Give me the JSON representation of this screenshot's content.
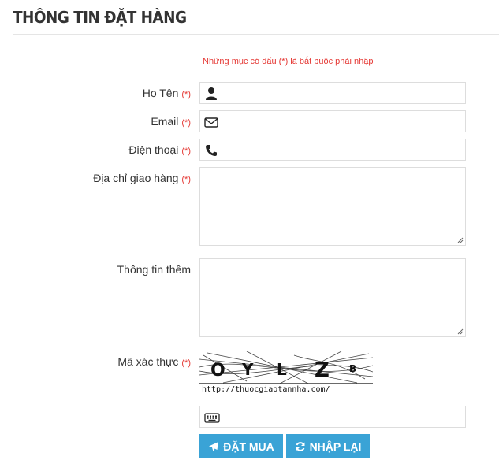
{
  "form": {
    "title": "THÔNG TIN ĐẶT HÀNG",
    "required_note": "Những mục có dấu (*) là bắt buộc phải nhập",
    "required_marker": "(*)",
    "fields": {
      "name": {
        "label": "Họ Tên",
        "value": "",
        "icon": "user-icon"
      },
      "email": {
        "label": "Email",
        "value": "",
        "icon": "envelope-icon"
      },
      "phone": {
        "label": "Điện thoại",
        "value": "",
        "icon": "phone-icon"
      },
      "address": {
        "label": "Địa chỉ giao hàng",
        "value": ""
      },
      "extra": {
        "label": "Thông tin thêm",
        "value": ""
      },
      "captcha": {
        "label": "Mã xác thực",
        "value": "",
        "icon": "keyboard-icon"
      }
    },
    "captcha": {
      "characters": [
        "O",
        "Y",
        "L",
        "Z",
        "B"
      ],
      "url": "http://thuocgiaotannha.com/"
    },
    "buttons": {
      "submit_label": "ĐẶT MUA",
      "reset_label": "NHẬP LẠI"
    },
    "colors": {
      "required": "#e53935",
      "button": "#3aa3d6",
      "border": "#dddddd"
    }
  }
}
